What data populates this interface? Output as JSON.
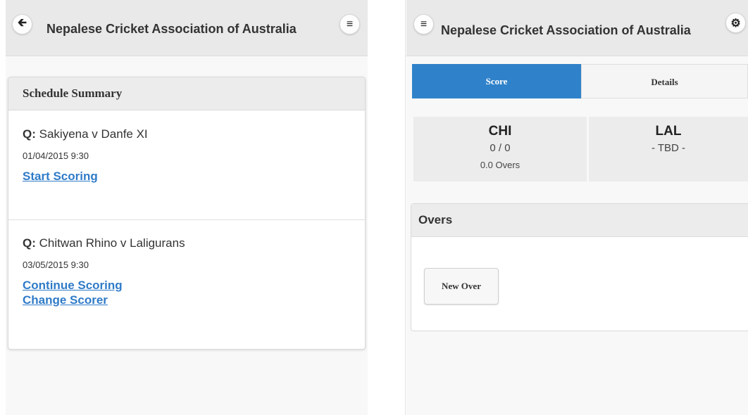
{
  "left_screen": {
    "header": {
      "title": "Nepalese Cricket Association of Australia",
      "back_icon": "arrow-left-icon",
      "menu_icon": "hamburger-icon"
    },
    "card": {
      "title": "Schedule Summary",
      "items": [
        {
          "prefix": "Q:",
          "match": "Sakiyena v Danfe XI",
          "datetime": "01/04/2015 9:30",
          "links": [
            "Start Scoring"
          ]
        },
        {
          "prefix": "Q:",
          "match": "Chitwan Rhino v Laligurans",
          "datetime": "03/05/2015 9:30",
          "links": [
            "Continue Scoring",
            "Change Scorer"
          ]
        }
      ]
    }
  },
  "right_screen": {
    "header": {
      "title": "Nepalese Cricket Association of Australia",
      "menu_icon": "hamburger-icon",
      "settings_icon": "gear-icon"
    },
    "tabs": [
      {
        "label": "Score",
        "active": true
      },
      {
        "label": "Details",
        "active": false
      }
    ],
    "teams": [
      {
        "abbr": "CHI",
        "score": "0 / 0",
        "overs": "0.0 Overs"
      },
      {
        "abbr": "LAL",
        "score": "- TBD -",
        "overs": ""
      }
    ],
    "overs_panel": {
      "title": "Overs",
      "button": "New Over"
    },
    "colors": {
      "tab_active": "#2f82c9",
      "link": "#2f7bc8"
    }
  }
}
